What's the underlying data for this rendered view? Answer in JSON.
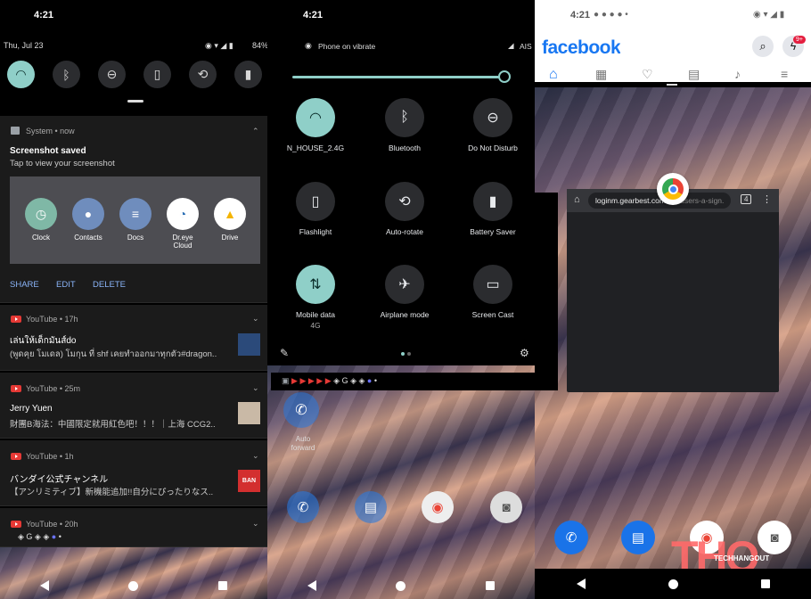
{
  "panel1": {
    "time": "4:21",
    "date": "Thu, Jul 23",
    "battery": "84%",
    "notif": {
      "source": "System • now",
      "title": "Screenshot saved",
      "body": "Tap to view your screenshot",
      "apps": [
        {
          "label": "Clock"
        },
        {
          "label": "Contacts"
        },
        {
          "label": "Docs"
        },
        {
          "label": "Dr.eye\nCloud"
        },
        {
          "label": "Drive"
        }
      ],
      "actions": [
        "SHARE",
        "EDIT",
        "DELETE"
      ]
    },
    "yt": [
      {
        "source": "YouTube • 17h",
        "title": "เล่นให้เด็กมันส์do",
        "body": "(พูดคุย โมเดล) โมกุน ที่ shf เคยทำออกมาทุกตัว#dragon.."
      },
      {
        "source": "YouTube • 25m",
        "title": "Jerry Yuen",
        "body": "財團B海法：中國限定就用紅色吧！！！｜上海 CCG2.."
      },
      {
        "source": "YouTube • 1h",
        "title": "バンダイ公式チャンネル",
        "body": "【アンリミティブ】新機能追加!!自分にぴったりなス.."
      },
      {
        "source": "YouTube • 20h"
      }
    ]
  },
  "panel2": {
    "time": "4:21",
    "status": "Phone on vibrate",
    "carrier": "AIS",
    "tiles": [
      {
        "label": "N_HOUSE_2.4G",
        "sub": "",
        "icon": "wifi-icon",
        "glyph": "◠"
      },
      {
        "label": "Bluetooth",
        "sub": "",
        "icon": "bluetooth-icon",
        "glyph": "ᛒ"
      },
      {
        "label": "Do Not Disturb",
        "sub": "",
        "icon": "dnd-icon",
        "glyph": "⊖"
      },
      {
        "label": "Flashlight",
        "sub": "",
        "icon": "flashlight-icon",
        "glyph": "▯"
      },
      {
        "label": "Auto-rotate",
        "sub": "",
        "icon": "rotate-icon",
        "glyph": "⟲"
      },
      {
        "label": "Battery Saver",
        "sub": "",
        "icon": "battery-saver-icon",
        "glyph": "▮"
      },
      {
        "label": "Mobile data",
        "sub": "4G",
        "icon": "mobile-data-icon",
        "glyph": "⇅"
      },
      {
        "label": "Airplane mode",
        "sub": "",
        "icon": "airplane-icon",
        "glyph": "✈"
      },
      {
        "label": "Screen Cast",
        "sub": "",
        "icon": "cast-icon",
        "glyph": "▭"
      }
    ],
    "home": {
      "app_label": "Auto\nforward"
    }
  },
  "panel3": {
    "time": "4:21",
    "brand": "facebook",
    "badge": "9+",
    "chrome": {
      "url": "loginm.gearbest.com",
      "url_rest": "/m-users-a-sign.",
      "tabs": "4"
    },
    "watermark": {
      "big": "THO",
      "small": "TECHHANGOUT"
    }
  },
  "colors": {
    "accent": "#8fcfc8",
    "fb": "#1877f2",
    "yt": "#e53935",
    "link": "#8ab4f8"
  }
}
